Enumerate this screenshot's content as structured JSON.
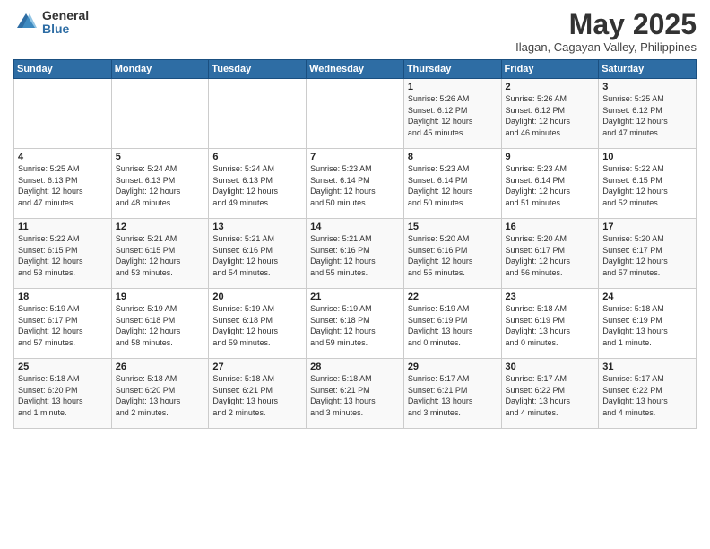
{
  "header": {
    "logo_general": "General",
    "logo_blue": "Blue",
    "title": "May 2025",
    "location": "Ilagan, Cagayan Valley, Philippines"
  },
  "weekdays": [
    "Sunday",
    "Monday",
    "Tuesday",
    "Wednesday",
    "Thursday",
    "Friday",
    "Saturday"
  ],
  "weeks": [
    [
      {
        "day": "",
        "info": ""
      },
      {
        "day": "",
        "info": ""
      },
      {
        "day": "",
        "info": ""
      },
      {
        "day": "",
        "info": ""
      },
      {
        "day": "1",
        "info": "Sunrise: 5:26 AM\nSunset: 6:12 PM\nDaylight: 12 hours\nand 45 minutes."
      },
      {
        "day": "2",
        "info": "Sunrise: 5:26 AM\nSunset: 6:12 PM\nDaylight: 12 hours\nand 46 minutes."
      },
      {
        "day": "3",
        "info": "Sunrise: 5:25 AM\nSunset: 6:12 PM\nDaylight: 12 hours\nand 47 minutes."
      }
    ],
    [
      {
        "day": "4",
        "info": "Sunrise: 5:25 AM\nSunset: 6:13 PM\nDaylight: 12 hours\nand 47 minutes."
      },
      {
        "day": "5",
        "info": "Sunrise: 5:24 AM\nSunset: 6:13 PM\nDaylight: 12 hours\nand 48 minutes."
      },
      {
        "day": "6",
        "info": "Sunrise: 5:24 AM\nSunset: 6:13 PM\nDaylight: 12 hours\nand 49 minutes."
      },
      {
        "day": "7",
        "info": "Sunrise: 5:23 AM\nSunset: 6:14 PM\nDaylight: 12 hours\nand 50 minutes."
      },
      {
        "day": "8",
        "info": "Sunrise: 5:23 AM\nSunset: 6:14 PM\nDaylight: 12 hours\nand 50 minutes."
      },
      {
        "day": "9",
        "info": "Sunrise: 5:23 AM\nSunset: 6:14 PM\nDaylight: 12 hours\nand 51 minutes."
      },
      {
        "day": "10",
        "info": "Sunrise: 5:22 AM\nSunset: 6:15 PM\nDaylight: 12 hours\nand 52 minutes."
      }
    ],
    [
      {
        "day": "11",
        "info": "Sunrise: 5:22 AM\nSunset: 6:15 PM\nDaylight: 12 hours\nand 53 minutes."
      },
      {
        "day": "12",
        "info": "Sunrise: 5:21 AM\nSunset: 6:15 PM\nDaylight: 12 hours\nand 53 minutes."
      },
      {
        "day": "13",
        "info": "Sunrise: 5:21 AM\nSunset: 6:16 PM\nDaylight: 12 hours\nand 54 minutes."
      },
      {
        "day": "14",
        "info": "Sunrise: 5:21 AM\nSunset: 6:16 PM\nDaylight: 12 hours\nand 55 minutes."
      },
      {
        "day": "15",
        "info": "Sunrise: 5:20 AM\nSunset: 6:16 PM\nDaylight: 12 hours\nand 55 minutes."
      },
      {
        "day": "16",
        "info": "Sunrise: 5:20 AM\nSunset: 6:17 PM\nDaylight: 12 hours\nand 56 minutes."
      },
      {
        "day": "17",
        "info": "Sunrise: 5:20 AM\nSunset: 6:17 PM\nDaylight: 12 hours\nand 57 minutes."
      }
    ],
    [
      {
        "day": "18",
        "info": "Sunrise: 5:19 AM\nSunset: 6:17 PM\nDaylight: 12 hours\nand 57 minutes."
      },
      {
        "day": "19",
        "info": "Sunrise: 5:19 AM\nSunset: 6:18 PM\nDaylight: 12 hours\nand 58 minutes."
      },
      {
        "day": "20",
        "info": "Sunrise: 5:19 AM\nSunset: 6:18 PM\nDaylight: 12 hours\nand 59 minutes."
      },
      {
        "day": "21",
        "info": "Sunrise: 5:19 AM\nSunset: 6:18 PM\nDaylight: 12 hours\nand 59 minutes."
      },
      {
        "day": "22",
        "info": "Sunrise: 5:19 AM\nSunset: 6:19 PM\nDaylight: 13 hours\nand 0 minutes."
      },
      {
        "day": "23",
        "info": "Sunrise: 5:18 AM\nSunset: 6:19 PM\nDaylight: 13 hours\nand 0 minutes."
      },
      {
        "day": "24",
        "info": "Sunrise: 5:18 AM\nSunset: 6:19 PM\nDaylight: 13 hours\nand 1 minute."
      }
    ],
    [
      {
        "day": "25",
        "info": "Sunrise: 5:18 AM\nSunset: 6:20 PM\nDaylight: 13 hours\nand 1 minute."
      },
      {
        "day": "26",
        "info": "Sunrise: 5:18 AM\nSunset: 6:20 PM\nDaylight: 13 hours\nand 2 minutes."
      },
      {
        "day": "27",
        "info": "Sunrise: 5:18 AM\nSunset: 6:21 PM\nDaylight: 13 hours\nand 2 minutes."
      },
      {
        "day": "28",
        "info": "Sunrise: 5:18 AM\nSunset: 6:21 PM\nDaylight: 13 hours\nand 3 minutes."
      },
      {
        "day": "29",
        "info": "Sunrise: 5:17 AM\nSunset: 6:21 PM\nDaylight: 13 hours\nand 3 minutes."
      },
      {
        "day": "30",
        "info": "Sunrise: 5:17 AM\nSunset: 6:22 PM\nDaylight: 13 hours\nand 4 minutes."
      },
      {
        "day": "31",
        "info": "Sunrise: 5:17 AM\nSunset: 6:22 PM\nDaylight: 13 hours\nand 4 minutes."
      }
    ]
  ]
}
